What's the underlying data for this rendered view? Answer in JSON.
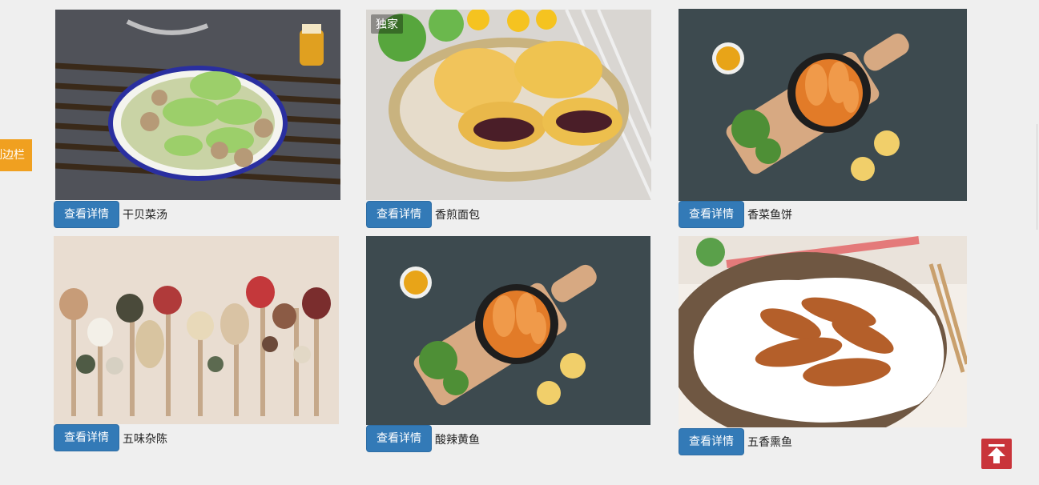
{
  "sidebar": {
    "label": "侧边栏"
  },
  "back_to_top": {
    "icon": "arrow-up-to-line-icon",
    "color": "#c9343a"
  },
  "detail_button_color": "#337ab7",
  "cards": [
    {
      "name": "干贝菜汤",
      "button": "查看详情",
      "badge": ""
    },
    {
      "name": "香煎面包",
      "button": "查看详情",
      "badge": "独家"
    },
    {
      "name": "香菜鱼饼",
      "button": "查看详情",
      "badge": ""
    },
    {
      "name": "五味杂陈",
      "button": "查看详情",
      "badge": ""
    },
    {
      "name": "酸辣黄鱼",
      "button": "查看详情",
      "badge": ""
    },
    {
      "name": "五香熏鱼",
      "button": "查看详情",
      "badge": ""
    }
  ]
}
